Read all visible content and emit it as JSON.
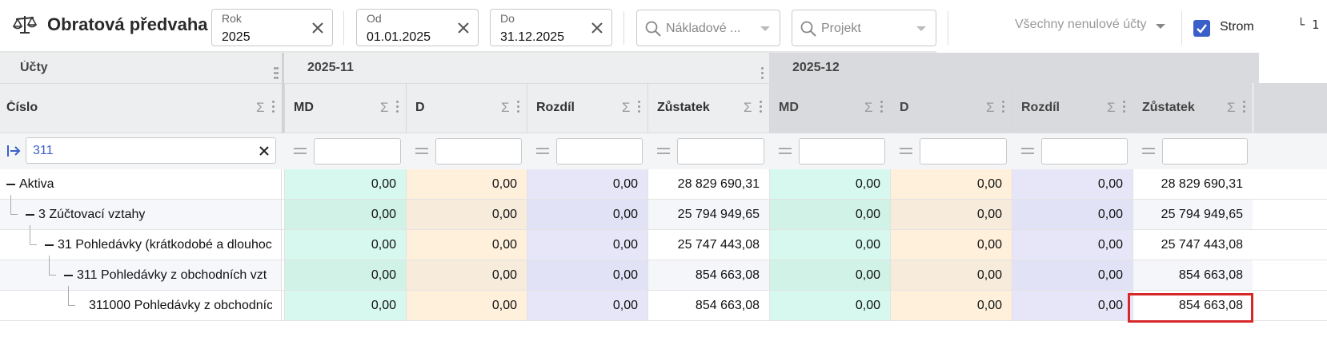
{
  "header": {
    "title": "Obratová předvaha",
    "rok": {
      "label": "Rok",
      "value": "2025"
    },
    "od": {
      "label": "Od",
      "value": "01.01.2025"
    },
    "do": {
      "label": "Do",
      "value": "31.12.2025"
    },
    "cost_center": {
      "placeholder": "Nákladové ..."
    },
    "project": {
      "placeholder": "Projekt"
    },
    "accounts_filter": "Všechny nenulové účty",
    "tree_checkbox": {
      "label": "Strom",
      "checked": true
    },
    "level_indicator": "└ 1"
  },
  "grid": {
    "accounts_group": "Účty",
    "number_col": "Číslo",
    "filter_value": "311",
    "periods": [
      {
        "label": "2025-11",
        "columns": [
          "MD",
          "D",
          "Rozdíl",
          "Zůstatek"
        ]
      },
      {
        "label": "2025-12",
        "columns": [
          "MD",
          "D",
          "Rozdíl",
          "Zůstatek"
        ]
      }
    ],
    "rows": [
      {
        "label": "Aktiva",
        "level": 0,
        "p1": [
          "0,00",
          "0,00",
          "0,00",
          "28 829 690,31"
        ],
        "p2": [
          "0,00",
          "0,00",
          "0,00",
          "28 829 690,31"
        ]
      },
      {
        "label": "3 Zúčtovací vztahy",
        "level": 1,
        "p1": [
          "0,00",
          "0,00",
          "0,00",
          "25 794 949,65"
        ],
        "p2": [
          "0,00",
          "0,00",
          "0,00",
          "25 794 949,65"
        ]
      },
      {
        "label": "31 Pohledávky (krátkodobé a dlouhoc",
        "level": 2,
        "p1": [
          "0,00",
          "0,00",
          "0,00",
          "25 747 443,08"
        ],
        "p2": [
          "0,00",
          "0,00",
          "0,00",
          "25 747 443,08"
        ]
      },
      {
        "label": "311 Pohledávky z obchodních vzt",
        "level": 3,
        "p1": [
          "0,00",
          "0,00",
          "0,00",
          "854 663,08"
        ],
        "p2": [
          "0,00",
          "0,00",
          "0,00",
          "854 663,08"
        ]
      },
      {
        "label": "311000 Pohledávky z obchodníc",
        "level": 4,
        "p1": [
          "0,00",
          "0,00",
          "0,00",
          "854 663,08"
        ],
        "p2": [
          "0,00",
          "0,00",
          "0,00",
          "854 663,08"
        ]
      }
    ]
  },
  "colors": {
    "accent": "#3b5fc9",
    "highlight": "#d62828",
    "md": "#d6f8ee",
    "d": "#fff0dc",
    "rozdil": "#e6e6f8"
  },
  "icons": {
    "app": "scale-icon",
    "clear": "close-icon",
    "search": "search-icon",
    "filter_mode": "arrow-right-bar-icon",
    "sum": "sigma-icon",
    "menu": "dots-vertical-icon"
  }
}
